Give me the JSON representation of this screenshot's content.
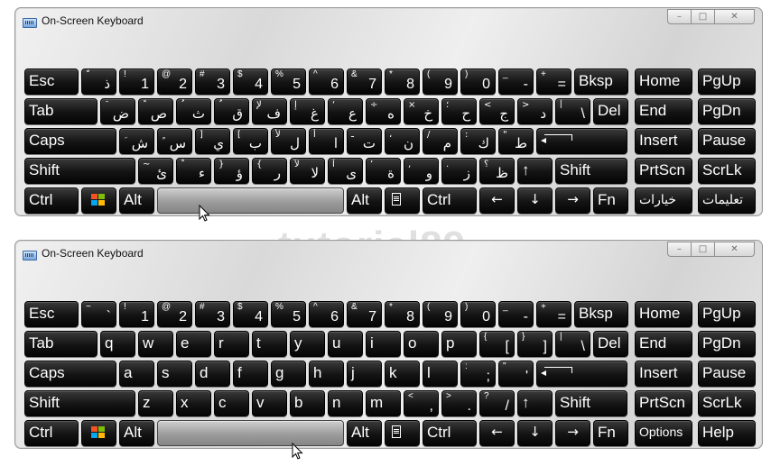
{
  "watermark": "tutorial89",
  "window1": {
    "title": "On-Screen Keyboard",
    "layout": "arabic",
    "rows": [
      [
        {
          "main": "Esc",
          "w": 60
        },
        {
          "top": "ّ",
          "bot": "ذ",
          "w": 39,
          "ar": true
        },
        {
          "top": "!",
          "bot": "1",
          "w": 39
        },
        {
          "top": "@",
          "bot": "2",
          "w": 39
        },
        {
          "top": "#",
          "bot": "3",
          "w": 39
        },
        {
          "top": "$",
          "bot": "4",
          "w": 39
        },
        {
          "top": "%",
          "bot": "5",
          "w": 39
        },
        {
          "top": "^",
          "bot": "6",
          "w": 39
        },
        {
          "top": "&",
          "bot": "7",
          "w": 39
        },
        {
          "top": "*",
          "bot": "8",
          "w": 39
        },
        {
          "top": "(",
          "bot": "9",
          "w": 39
        },
        {
          "top": ")",
          "bot": "0",
          "w": 39
        },
        {
          "top": "_",
          "bot": "-",
          "w": 39
        },
        {
          "top": "+",
          "bot": "=",
          "w": 39
        },
        {
          "main": "Bksp",
          "w": 60
        }
      ],
      [
        {
          "main": "Tab",
          "w": 81
        },
        {
          "top": "َ",
          "bot": "ض",
          "w": 39,
          "ar": true
        },
        {
          "top": "ً",
          "bot": "ص",
          "w": 39,
          "ar": true
        },
        {
          "top": "ُ",
          "bot": "ث",
          "w": 39,
          "ar": true
        },
        {
          "top": "ٌ",
          "bot": "ق",
          "w": 39,
          "ar": true
        },
        {
          "top": "لإ",
          "bot": "ف",
          "w": 39,
          "ar": true
        },
        {
          "top": "إ",
          "bot": "غ",
          "w": 39,
          "ar": true
        },
        {
          "top": "‘",
          "bot": "ع",
          "w": 39,
          "ar": true
        },
        {
          "top": "÷",
          "bot": "ه",
          "w": 39,
          "ar": true
        },
        {
          "top": "×",
          "bot": "خ",
          "w": 39,
          "ar": true
        },
        {
          "top": "؛",
          "bot": "ح",
          "w": 39,
          "ar": true
        },
        {
          "top": "<",
          "bot": "ج",
          "w": 39,
          "ar": true
        },
        {
          "top": ">",
          "bot": "د",
          "w": 39,
          "ar": true
        },
        {
          "top": "|",
          "bot": "\\",
          "w": 39
        },
        {
          "main": "Del",
          "w": 39
        }
      ],
      [
        {
          "main": "Caps",
          "w": 102
        },
        {
          "top": "ِ",
          "bot": "ش",
          "w": 39,
          "ar": true
        },
        {
          "top": "ٍ",
          "bot": "س",
          "w": 39,
          "ar": true
        },
        {
          "top": "]",
          "bot": "ي",
          "w": 39,
          "ar": true
        },
        {
          "top": "[",
          "bot": "ب",
          "w": 39,
          "ar": true
        },
        {
          "top": "لأ",
          "bot": "ل",
          "w": 39,
          "ar": true
        },
        {
          "top": "أ",
          "bot": "ا",
          "w": 39,
          "ar": true
        },
        {
          "top": "ـ",
          "bot": "ت",
          "w": 39,
          "ar": true
        },
        {
          "top": "،",
          "bot": "ن",
          "w": 39,
          "ar": true
        },
        {
          "top": "/",
          "bot": "م",
          "w": 39,
          "ar": true
        },
        {
          "top": ":",
          "bot": "ك",
          "w": 39,
          "ar": true
        },
        {
          "top": "\"",
          "bot": "ط",
          "w": 39,
          "ar": true
        },
        {
          "enter": true,
          "w": 101
        }
      ],
      [
        {
          "main": "Shift",
          "w": 123
        },
        {
          "top": "~",
          "bot": "ئ",
          "w": 39,
          "ar": true
        },
        {
          "top": "ْ",
          "bot": "ء",
          "w": 39,
          "ar": true
        },
        {
          "top": "}",
          "bot": "ؤ",
          "w": 39,
          "ar": true
        },
        {
          "top": "{",
          "bot": "ر",
          "w": 39,
          "ar": true
        },
        {
          "top": "لآ",
          "bot": "لا",
          "w": 39,
          "ar": true
        },
        {
          "top": "آ",
          "bot": "ى",
          "w": 39,
          "ar": true
        },
        {
          "top": "’",
          "bot": "ة",
          "w": 39,
          "ar": true
        },
        {
          "top": ",",
          "bot": "و",
          "w": 39,
          "ar": true
        },
        {
          "top": ".",
          "bot": "ز",
          "w": 39,
          "ar": true
        },
        {
          "top": "؟",
          "bot": "ظ",
          "w": 39,
          "ar": true
        },
        {
          "main": "↑",
          "w": 39
        },
        {
          "main": "Shift",
          "w": 80
        }
      ],
      [
        {
          "main": "Ctrl",
          "w": 60
        },
        {
          "win": true,
          "w": 39
        },
        {
          "main": "Alt",
          "w": 39
        },
        {
          "space": true,
          "w": 207
        },
        {
          "main": "Alt",
          "w": 39
        },
        {
          "menu": true,
          "w": 39
        },
        {
          "main": "Ctrl",
          "w": 60
        },
        {
          "main": "←",
          "w": 39,
          "small": true
        },
        {
          "main": "↓",
          "w": 39,
          "small": true
        },
        {
          "main": "→",
          "w": 39,
          "small": true
        },
        {
          "main": "Fn",
          "w": 39
        }
      ]
    ],
    "right": [
      [
        {
          "main": "Home"
        },
        {
          "main": "PgUp"
        }
      ],
      [
        {
          "main": "End"
        },
        {
          "main": "PgDn"
        }
      ],
      [
        {
          "main": "Insert"
        },
        {
          "main": "Pause"
        }
      ],
      [
        {
          "main": "PrtScn"
        },
        {
          "main": "ScrLk"
        }
      ],
      [
        {
          "main": "خيارات",
          "opt": true
        },
        {
          "main": "تعليمات",
          "opt": true
        }
      ]
    ]
  },
  "window2": {
    "title": "On-Screen Keyboard",
    "layout": "english",
    "rows": [
      [
        {
          "main": "Esc",
          "w": 60
        },
        {
          "top": "~",
          "bot": "`",
          "w": 39
        },
        {
          "top": "!",
          "bot": "1",
          "w": 39
        },
        {
          "top": "@",
          "bot": "2",
          "w": 39
        },
        {
          "top": "#",
          "bot": "3",
          "w": 39
        },
        {
          "top": "$",
          "bot": "4",
          "w": 39
        },
        {
          "top": "%",
          "bot": "5",
          "w": 39
        },
        {
          "top": "^",
          "bot": "6",
          "w": 39
        },
        {
          "top": "&",
          "bot": "7",
          "w": 39
        },
        {
          "top": "*",
          "bot": "8",
          "w": 39
        },
        {
          "top": "(",
          "bot": "9",
          "w": 39
        },
        {
          "top": ")",
          "bot": "0",
          "w": 39
        },
        {
          "top": "_",
          "bot": "-",
          "w": 39
        },
        {
          "top": "+",
          "bot": "=",
          "w": 39
        },
        {
          "main": "Bksp",
          "w": 60
        }
      ],
      [
        {
          "main": "Tab",
          "w": 81
        },
        {
          "main": "q",
          "w": 39
        },
        {
          "main": "w",
          "w": 39
        },
        {
          "main": "e",
          "w": 39
        },
        {
          "main": "r",
          "w": 39
        },
        {
          "main": "t",
          "w": 39
        },
        {
          "main": "y",
          "w": 39
        },
        {
          "main": "u",
          "w": 39
        },
        {
          "main": "i",
          "w": 39
        },
        {
          "main": "o",
          "w": 39
        },
        {
          "main": "p",
          "w": 39
        },
        {
          "top": "{",
          "bot": "[",
          "w": 39
        },
        {
          "top": "}",
          "bot": "]",
          "w": 39
        },
        {
          "top": "|",
          "bot": "\\",
          "w": 39
        },
        {
          "main": "Del",
          "w": 39
        }
      ],
      [
        {
          "main": "Caps",
          "w": 102
        },
        {
          "main": "a",
          "w": 39
        },
        {
          "main": "s",
          "w": 39
        },
        {
          "main": "d",
          "w": 39
        },
        {
          "main": "f",
          "w": 39
        },
        {
          "main": "g",
          "w": 39
        },
        {
          "main": "h",
          "w": 39
        },
        {
          "main": "j",
          "w": 39
        },
        {
          "main": "k",
          "w": 39
        },
        {
          "main": "l",
          "w": 39
        },
        {
          "top": ":",
          "bot": ";",
          "w": 39
        },
        {
          "top": "\"",
          "bot": "'",
          "w": 39
        },
        {
          "enter": true,
          "w": 101
        }
      ],
      [
        {
          "main": "Shift",
          "w": 123
        },
        {
          "main": "z",
          "w": 39
        },
        {
          "main": "x",
          "w": 39
        },
        {
          "main": "c",
          "w": 39
        },
        {
          "main": "v",
          "w": 39
        },
        {
          "main": "b",
          "w": 39
        },
        {
          "main": "n",
          "w": 39
        },
        {
          "main": "m",
          "w": 39
        },
        {
          "top": "<",
          "bot": ",",
          "w": 39
        },
        {
          "top": ">",
          "bot": ".",
          "w": 39
        },
        {
          "top": "?",
          "bot": "/",
          "w": 39
        },
        {
          "main": "↑",
          "w": 39
        },
        {
          "main": "Shift",
          "w": 80
        }
      ],
      [
        {
          "main": "Ctrl",
          "w": 60
        },
        {
          "win": true,
          "w": 39
        },
        {
          "main": "Alt",
          "w": 39
        },
        {
          "space": true,
          "w": 207
        },
        {
          "main": "Alt",
          "w": 39
        },
        {
          "menu": true,
          "w": 39
        },
        {
          "main": "Ctrl",
          "w": 60
        },
        {
          "main": "←",
          "w": 39,
          "small": true
        },
        {
          "main": "↓",
          "w": 39,
          "small": true
        },
        {
          "main": "→",
          "w": 39,
          "small": true
        },
        {
          "main": "Fn",
          "w": 39
        }
      ]
    ],
    "right": [
      [
        {
          "main": "Home"
        },
        {
          "main": "PgUp"
        }
      ],
      [
        {
          "main": "End"
        },
        {
          "main": "PgDn"
        }
      ],
      [
        {
          "main": "Insert"
        },
        {
          "main": "Pause"
        }
      ],
      [
        {
          "main": "PrtScn"
        },
        {
          "main": "ScrLk"
        }
      ],
      [
        {
          "main": "Options",
          "opt": true
        },
        {
          "main": "Help"
        }
      ]
    ]
  },
  "colors": {
    "key_bg": "#0d0d0d",
    "key_text": "#ffffff",
    "space_bar": "#a9a9a9",
    "window_bg": "#e3e3e3"
  }
}
